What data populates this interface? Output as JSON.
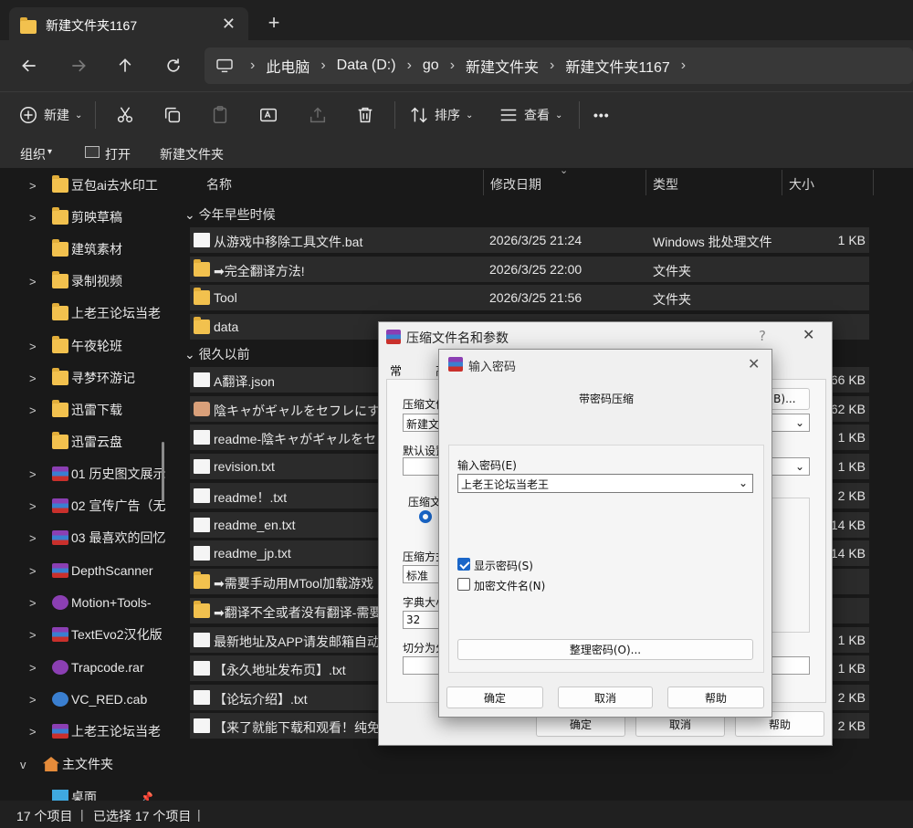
{
  "window": {
    "tab_title": "新建文件夹1167",
    "new_tab": "+",
    "close": "✕",
    "minimize": "—",
    "maximize": "☐"
  },
  "nav": {
    "back_icon": "arrow-left-icon",
    "forward_icon": "arrow-right-icon",
    "up_icon": "arrow-up-icon",
    "refresh_icon": "refresh-icon",
    "breadcrumbs": [
      "此电脑",
      "Data (D:)",
      "go",
      "新建文件夹",
      "新建文件夹1167"
    ]
  },
  "toolbar": {
    "new_label": "新建",
    "sort_label": "排序",
    "view_label": "查看",
    "more_label": "•••"
  },
  "subbar": {
    "organize": "组织",
    "open": "打开",
    "new_folder": "新建文件夹"
  },
  "sidebar": {
    "items": [
      {
        "label": "豆包ai去水印工",
        "icon": "folder-icon",
        "chevron": ">"
      },
      {
        "label": "剪映草稿",
        "icon": "folder-icon",
        "chevron": ">"
      },
      {
        "label": "建筑素材",
        "icon": "folder-icon",
        "chevron": ""
      },
      {
        "label": "录制视频",
        "icon": "folder-icon",
        "chevron": ">"
      },
      {
        "label": "上老王论坛当老",
        "icon": "folder-icon",
        "chevron": ""
      },
      {
        "label": "午夜轮班",
        "icon": "folder-icon",
        "chevron": ">"
      },
      {
        "label": "寻梦环游记",
        "icon": "folder-icon",
        "chevron": ">"
      },
      {
        "label": "迅雷下载",
        "icon": "folder-icon",
        "chevron": ">"
      },
      {
        "label": "迅雷云盘",
        "icon": "folder-icon",
        "chevron": ""
      },
      {
        "label": "01 历史图文展示",
        "icon": "rar-icon",
        "chevron": ">"
      },
      {
        "label": "02 宣传广告（无",
        "icon": "rar-icon",
        "chevron": ">"
      },
      {
        "label": "03 最喜欢的回忆",
        "icon": "rar-icon",
        "chevron": ">"
      },
      {
        "label": "DepthScanner",
        "icon": "rar-icon",
        "chevron": ">"
      },
      {
        "label": "Motion+Tools-",
        "icon": "rar-icon",
        "chevron": ">"
      },
      {
        "label": "TextEvo2汉化版",
        "icon": "rar-icon",
        "chevron": ">"
      },
      {
        "label": "Trapcode.rar",
        "icon": "rar-icon",
        "chevron": ">"
      },
      {
        "label": "VC_RED.cab",
        "icon": "cab-icon",
        "chevron": ">"
      },
      {
        "label": "上老王论坛当老",
        "icon": "rar-icon",
        "chevron": ">"
      },
      {
        "label": "主文件夹",
        "icon": "home-icon",
        "chevron": "v"
      },
      {
        "label": "桌面",
        "icon": "desktop-icon",
        "chevron": ""
      }
    ]
  },
  "columns": {
    "name": "名称",
    "date": "修改日期",
    "type": "类型",
    "size": "大小"
  },
  "groups": {
    "recent": "今年早些时候",
    "old": "很久以前"
  },
  "files": [
    {
      "name": "从游戏中移除工具文件.bat",
      "date": "2026/3/25 21:24",
      "type": "Windows 批处理文件",
      "size": "1 KB",
      "icon": "bat-icon"
    },
    {
      "name": "➡完全翻译方法!",
      "date": "2026/3/25 22:00",
      "type": "文件夹",
      "size": "",
      "icon": "folder-icon"
    },
    {
      "name": "Tool",
      "date": "2026/3/25 21:56",
      "type": "文件夹",
      "size": "",
      "icon": "folder-icon"
    },
    {
      "name": "data",
      "date": "",
      "type": "",
      "size": "",
      "icon": "folder-icon"
    },
    {
      "name": "A翻译.json",
      "date": "",
      "type": "",
      "size": "66 KB",
      "icon": "doc-icon"
    },
    {
      "name": "陰キャがギャルをセフレにする",
      "date": "",
      "type": "",
      "size": "62 KB",
      "icon": "image-icon"
    },
    {
      "name": "readme-陰キャがギャルをセフ",
      "date": "",
      "type": "",
      "size": "1 KB",
      "icon": "doc-icon"
    },
    {
      "name": "revision.txt",
      "date": "",
      "type": "",
      "size": "1 KB",
      "icon": "doc-icon"
    },
    {
      "name": "readme！.txt",
      "date": "",
      "type": "",
      "size": "2 KB",
      "icon": "doc-icon"
    },
    {
      "name": "readme_en.txt",
      "date": "",
      "type": "",
      "size": "14 KB",
      "icon": "doc-icon"
    },
    {
      "name": "readme_jp.txt",
      "date": "",
      "type": "",
      "size": "14 KB",
      "icon": "doc-icon"
    },
    {
      "name": "➡需要手动用MTool加载游戏",
      "date": "",
      "type": "",
      "size": "",
      "icon": "folder-icon"
    },
    {
      "name": "➡翻译不全或者没有翻译-需要",
      "date": "",
      "type": "",
      "size": "",
      "icon": "folder-icon"
    },
    {
      "name": "最新地址及APP请发邮箱自动获",
      "date": "",
      "type": "",
      "size": "1 KB",
      "icon": "doc-icon"
    },
    {
      "name": "【永久地址发布页】.txt",
      "date": "",
      "type": "",
      "size": "1 KB",
      "icon": "doc-icon"
    },
    {
      "name": "【论坛介绍】.txt",
      "date": "",
      "type": "",
      "size": "2 KB",
      "icon": "doc-icon"
    },
    {
      "name": "【来了就能下载和观看！纯免费",
      "date": "",
      "type": "",
      "size": "2 KB",
      "icon": "doc-icon"
    }
  ],
  "status": {
    "count": "17 个项目",
    "selected": "已选择 17 个项目"
  },
  "archive_dialog": {
    "title": "压缩文件名和参数",
    "help_q": "?",
    "tab_general": "常规",
    "tab_advanced": "高",
    "archive_name_label": "压缩文件",
    "archive_name_value": "新建文",
    "browse_button": "(B)...",
    "default_settings_label": "默认设置",
    "format_label": "压缩文",
    "method_label": "压缩方式",
    "method_value": "标准",
    "dict_label": "字典大小",
    "dict_value": "32",
    "split_label": "切分为分",
    "ok": "确定",
    "cancel": "取消",
    "help": "帮助"
  },
  "password_dialog": {
    "title": "输入密码",
    "heading": "带密码压缩",
    "enter_label": "输入密码(E)",
    "password_value": "上老王论坛当老王",
    "show_password": "显示密码(S)",
    "show_password_checked": true,
    "encrypt_names": "加密文件名(N)",
    "encrypt_names_checked": false,
    "organize_button": "整理密码(O)...",
    "ok": "确定",
    "cancel": "取消",
    "help": "帮助"
  }
}
